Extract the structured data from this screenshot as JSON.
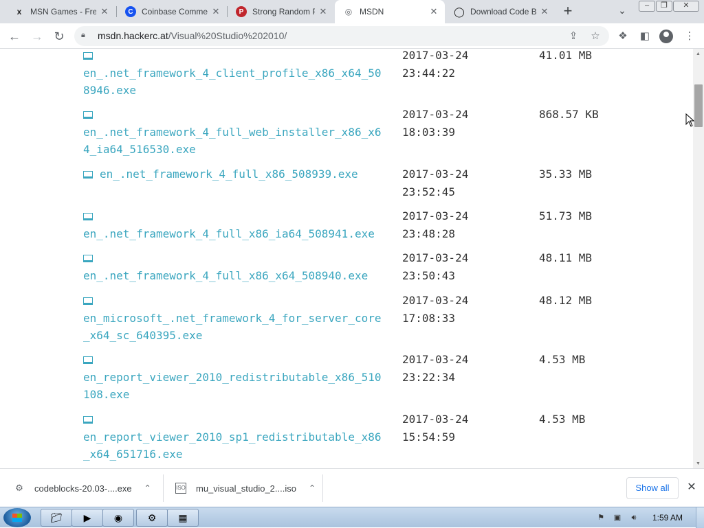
{
  "browser": {
    "tabs": [
      {
        "title": "MSN Games - Free",
        "icon": "msn-games-icon",
        "active": false
      },
      {
        "title": "Coinbase Commerce",
        "icon": "coinbase-icon",
        "active": false
      },
      {
        "title": "Strong Random Pa",
        "icon": "strong-random-icon",
        "active": false
      },
      {
        "title": "MSDN",
        "icon": "globe-icon",
        "active": true
      },
      {
        "title": "Download Code B",
        "icon": "download-code-icon",
        "active": false
      }
    ],
    "address": {
      "host": "msdn.hackerc.at",
      "path": "/Visual%20Studio%202010/"
    }
  },
  "files": [
    {
      "name": "en_.net_framework_4_client_profile_x86_x64_508946.exe",
      "date": "2017-03-24",
      "time": "23:44:22",
      "size": "41.01 MB"
    },
    {
      "name": "en_.net_framework_4_full_web_installer_x86_x64_ia64_516530.exe",
      "date": "2017-03-24",
      "time": "18:03:39",
      "size": "868.57 KB"
    },
    {
      "name": "en_.net_framework_4_full_x86_508939.exe",
      "date": "2017-03-24",
      "time": "23:52:45",
      "size": "35.33 MB"
    },
    {
      "name": "en_.net_framework_4_full_x86_ia64_508941.exe",
      "date": "2017-03-24",
      "time": "23:48:28",
      "size": "51.73 MB"
    },
    {
      "name": "en_.net_framework_4_full_x86_x64_508940.exe",
      "date": "2017-03-24",
      "time": "23:50:43",
      "size": "48.11 MB"
    },
    {
      "name": "en_microsoft_.net_framework_4_for_server_core_x64_sc_640395.exe",
      "date": "2017-03-24",
      "time": "17:08:33",
      "size": "48.12 MB"
    },
    {
      "name": "en_report_viewer_2010_redistributable_x86_510108.exe",
      "date": "2017-03-24",
      "time": "23:22:34",
      "size": "4.53 MB"
    },
    {
      "name": "en_report_viewer_2010_sp1_redistributable_x86_x64_651716.exe",
      "date": "2017-03-24",
      "time": "15:54:59",
      "size": "4.53 MB"
    }
  ],
  "downloads": {
    "items": [
      {
        "name": "codeblocks-20.03-....exe",
        "icon": "setup-file-icon"
      },
      {
        "name": "mu_visual_studio_2....iso",
        "icon": "iso-file-icon"
      }
    ],
    "show_all": "Show all"
  },
  "taskbar": {
    "clock": "1:59 AM"
  }
}
